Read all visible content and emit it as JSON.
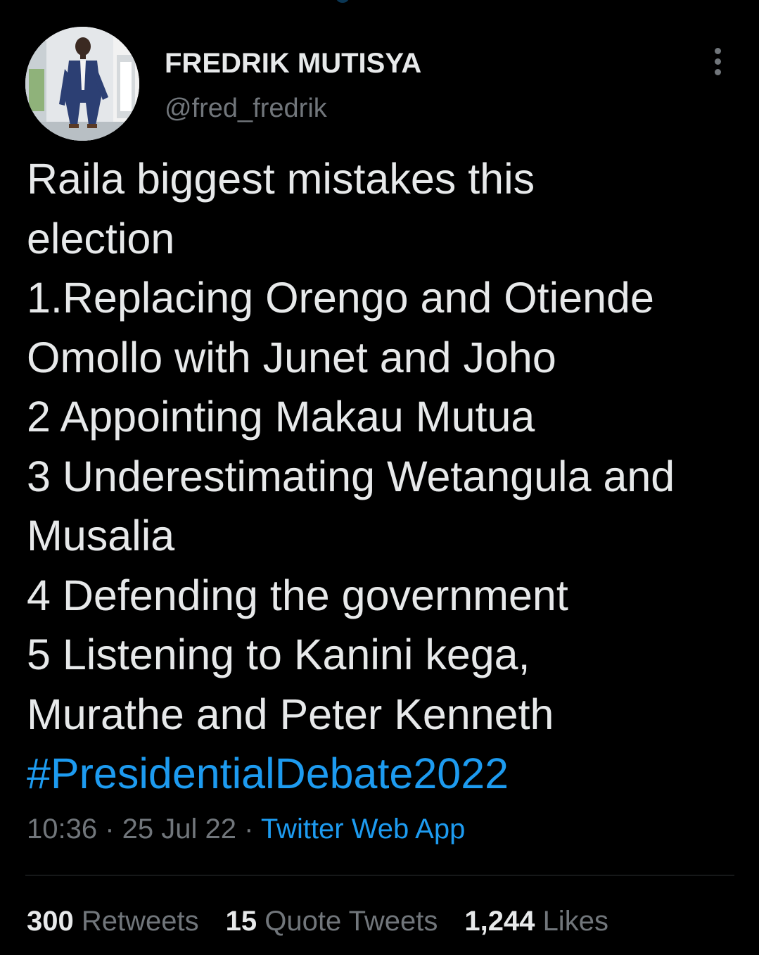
{
  "colors": {
    "background": "#000000",
    "text_primary": "#e7e9ea",
    "text_secondary": "#71767b",
    "link_blue": "#1d9bf0",
    "divider": "#2f3336"
  },
  "author": {
    "display_name": "FREDRIK MUTISYA",
    "handle": "@fred_fredrik",
    "avatar_icon": "profile-photo"
  },
  "more_menu": {
    "icon": "more-vertical-icon"
  },
  "tweet": {
    "lines": [
      "Raila biggest mistakes this",
      "election",
      "1.Replacing Orengo and Otiende",
      "Omollo with Junet and Joho",
      "2 Appointing Makau Mutua",
      "3 Underestimating Wetangula and",
      "Musalia",
      "4 Defending the government",
      "5 Listening to Kanini kega,",
      "Murathe and Peter Kenneth"
    ],
    "hashtag": "#PresidentialDebate2022"
  },
  "meta": {
    "time": "10:36",
    "separator": " · ",
    "date": "25 Jul 22",
    "source": "Twitter Web App"
  },
  "stats": {
    "retweets": {
      "count": "300",
      "label": "Retweets"
    },
    "quote_tweets": {
      "count": "15",
      "label": "Quote Tweets"
    },
    "likes": {
      "count": "1,244",
      "label": "Likes"
    }
  }
}
